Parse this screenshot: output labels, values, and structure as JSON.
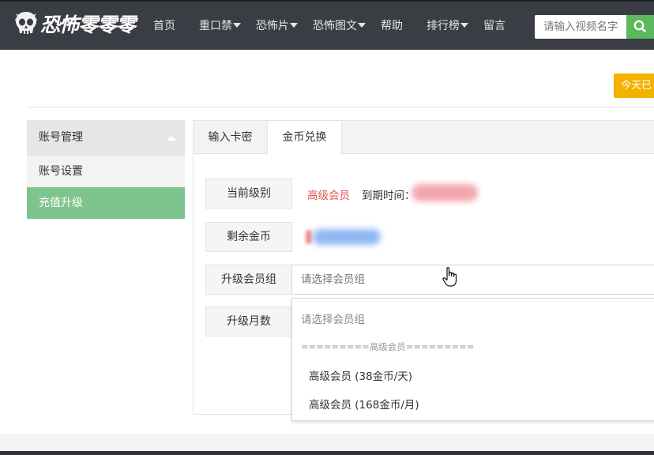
{
  "header": {
    "logo_text": "恐怖零零零",
    "nav": [
      {
        "label": "首页",
        "dropdown": false
      },
      {
        "label": "重口禁",
        "dropdown": true
      },
      {
        "label": "恐怖片",
        "dropdown": true
      },
      {
        "label": "恐怖图文",
        "dropdown": true
      },
      {
        "label": "帮助",
        "dropdown": false
      },
      {
        "label": "排行榜",
        "dropdown": true
      },
      {
        "label": "留言",
        "dropdown": false
      }
    ],
    "search_placeholder": "请输入视频名字",
    "search_icon": "search-icon"
  },
  "top_button": "今天已",
  "sidebar": {
    "header": "账号管理",
    "items": [
      {
        "label": "账号设置",
        "active": false
      },
      {
        "label": "充值升级",
        "active": true
      }
    ]
  },
  "tabs": [
    {
      "label": "输入卡密",
      "active": false
    },
    {
      "label": "金币兑换",
      "active": true
    }
  ],
  "form": {
    "level_label": "当前级别",
    "level_value": "高级会员",
    "expire_label": "到期时间：",
    "coins_label": "剩余金币",
    "group_label": "升级会员组",
    "group_placeholder": "请选择会员组",
    "months_label": "升级月数"
  },
  "dropdown": {
    "placeholder": "请选择会员组",
    "group_header": "=========高级会员=========",
    "options": [
      "高级会员 (38金币/天)",
      "高级会员 (168金币/月)"
    ]
  },
  "colors": {
    "header_bg": "#3a3d43",
    "accent_green": "#7ec48e",
    "search_green": "#5cb85c",
    "today_yellow": "#f5b100",
    "level_red": "#e5534b"
  }
}
